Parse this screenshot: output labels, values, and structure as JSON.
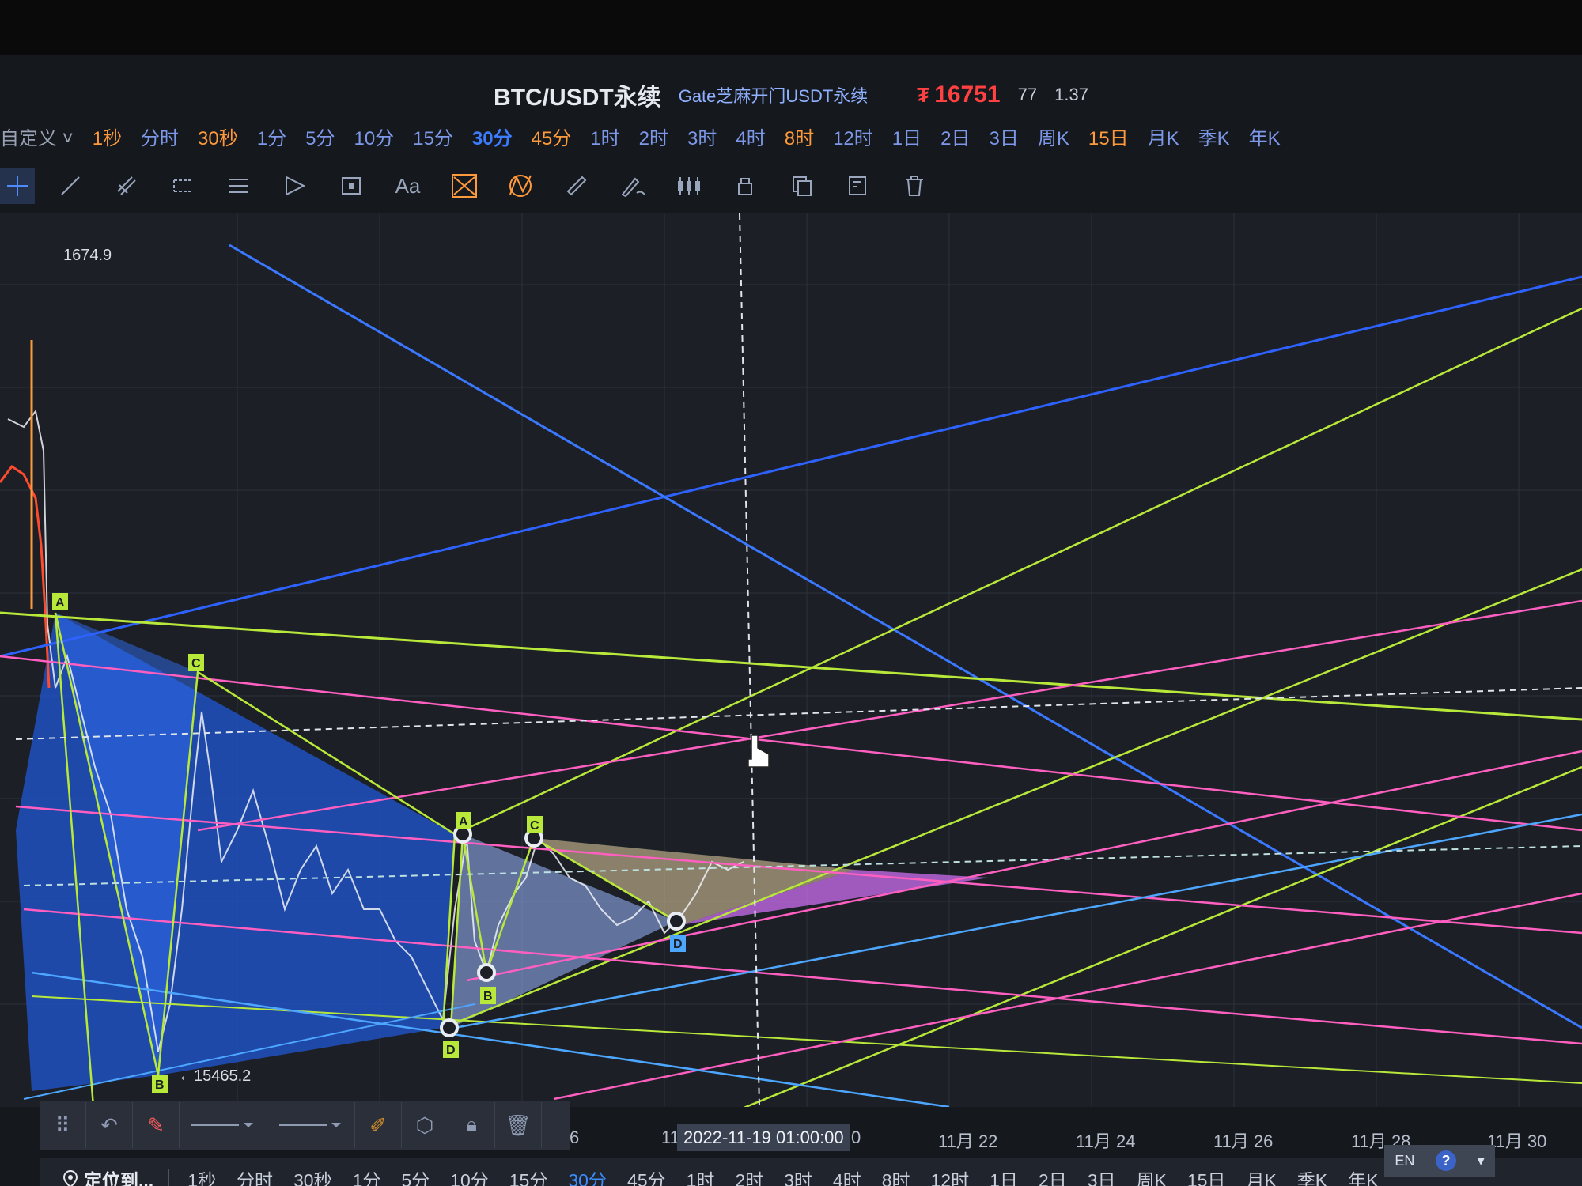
{
  "header": {
    "pair": "BTC/USDT永续",
    "subtitle": "Gate芝麻开门USDT永续",
    "price_mark": "₮",
    "price": "16751",
    "stat1": "77",
    "stat2": "1.37"
  },
  "timeframes_top": [
    {
      "label": "自定义 ˅",
      "style": "custom"
    },
    {
      "label": "1秒",
      "style": "orange"
    },
    {
      "label": "分时",
      "style": ""
    },
    {
      "label": "30秒",
      "style": "orange"
    },
    {
      "label": "1分",
      "style": ""
    },
    {
      "label": "5分",
      "style": ""
    },
    {
      "label": "10分",
      "style": ""
    },
    {
      "label": "15分",
      "style": ""
    },
    {
      "label": "30分",
      "style": "active"
    },
    {
      "label": "45分",
      "style": "orange"
    },
    {
      "label": "1时",
      "style": ""
    },
    {
      "label": "2时",
      "style": ""
    },
    {
      "label": "3时",
      "style": ""
    },
    {
      "label": "4时",
      "style": ""
    },
    {
      "label": "8时",
      "style": "orange"
    },
    {
      "label": "12时",
      "style": ""
    },
    {
      "label": "1日",
      "style": ""
    },
    {
      "label": "2日",
      "style": ""
    },
    {
      "label": "3日",
      "style": ""
    },
    {
      "label": "周K",
      "style": ""
    },
    {
      "label": "15日",
      "style": "orange"
    },
    {
      "label": "月K",
      "style": ""
    },
    {
      "label": "季K",
      "style": ""
    },
    {
      "label": "年K",
      "style": ""
    }
  ],
  "toolbar_icons": [
    "crosshair-icon",
    "line-icon",
    "parallel-line-icon",
    "channel-icon",
    "horizontal-lines-icon",
    "pitchfork-icon",
    "rectangle-icon",
    "text-icon",
    "pattern-icon",
    "harmonic-icon",
    "ruler-icon",
    "pencil-icon",
    "candles-icon",
    "lock-icon",
    "copy-icon",
    "settings-icon",
    "trash-icon"
  ],
  "toolbar_text_label": "Aa",
  "legend": {
    "price_hint": "1674.9"
  },
  "low_label": "←15465.2",
  "date_axis": {
    "left_fragment": "6",
    "crosshair_prefix": "11",
    "crosshair_date": "2022-11-19 01:00:00",
    "crosshair_suffix": "0",
    "ticks": [
      "11月 22",
      "11月 24",
      "11月 26",
      "11月 28",
      "11月 30"
    ]
  },
  "pattern_labels": {
    "a1": "A",
    "c1": "C",
    "b1": "B",
    "d1": "D",
    "a2": "A",
    "c2": "C",
    "b2": "B",
    "d2": "D"
  },
  "bottom_bar": {
    "locate": "定位到...",
    "timeframes": [
      {
        "label": "1秒",
        "active": false
      },
      {
        "label": "分时",
        "active": false
      },
      {
        "label": "30秒",
        "active": false
      },
      {
        "label": "1分",
        "active": false
      },
      {
        "label": "5分",
        "active": false
      },
      {
        "label": "10分",
        "active": false
      },
      {
        "label": "15分",
        "active": false
      },
      {
        "label": "30分",
        "active": true
      },
      {
        "label": "45分",
        "active": false
      },
      {
        "label": "1时",
        "active": false
      },
      {
        "label": "2时",
        "active": false
      },
      {
        "label": "3时",
        "active": false
      },
      {
        "label": "4时",
        "active": false
      },
      {
        "label": "8时",
        "active": false
      },
      {
        "label": "12时",
        "active": false
      },
      {
        "label": "1日",
        "active": false
      },
      {
        "label": "2日",
        "active": false
      },
      {
        "label": "3日",
        "active": false
      },
      {
        "label": "周K",
        "active": false
      },
      {
        "label": "15日",
        "active": false
      },
      {
        "label": "月K",
        "active": false
      },
      {
        "label": "季K",
        "active": false
      },
      {
        "label": "年K",
        "active": false
      }
    ]
  },
  "ime": {
    "lang": "EN",
    "help": "?"
  },
  "colors": {
    "blue_line": "#2e62ff",
    "lime_line": "#b8e83a",
    "pink_line": "#ff5fc0",
    "light_blue_line": "#4da6ff",
    "pattern_fill_blue": "#1f57d6",
    "pattern_fill_pink": "#d873ff",
    "pattern_fill_beige": "#e8d2a4",
    "price_up": "#ff4141"
  }
}
